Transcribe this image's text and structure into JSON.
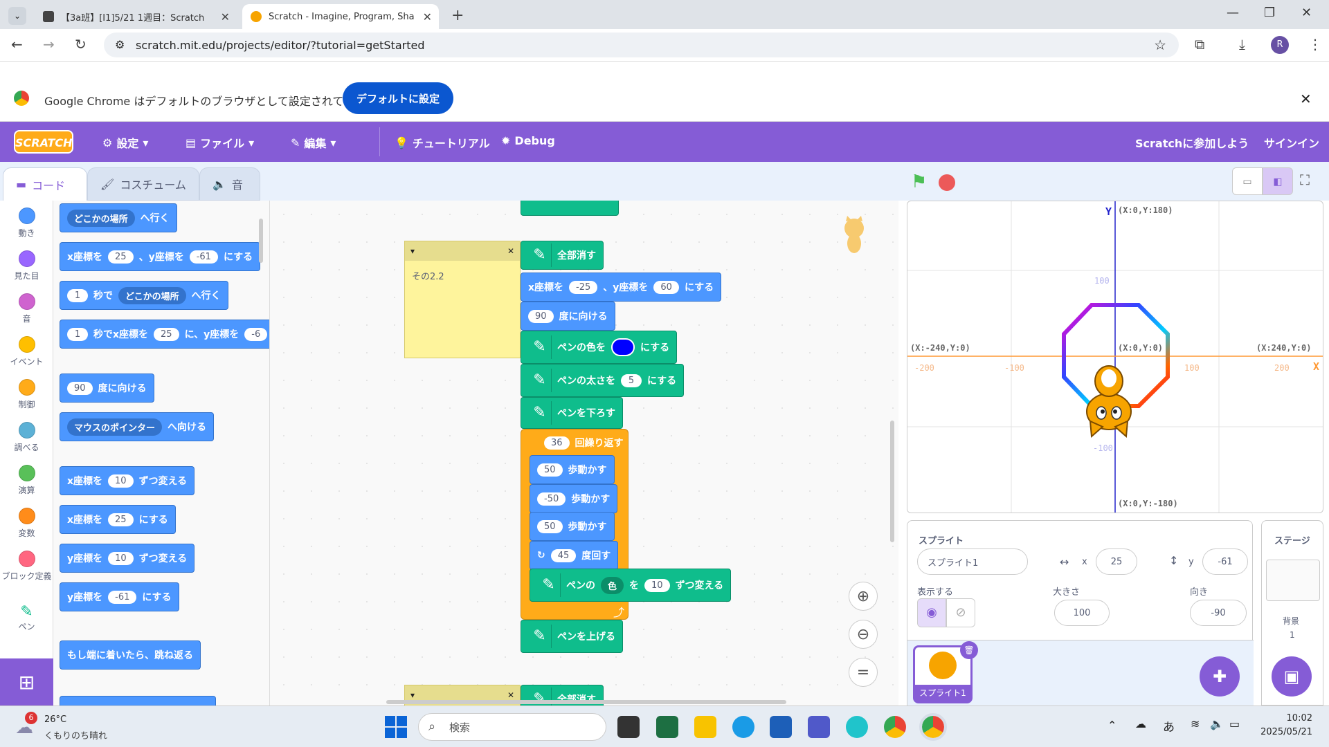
{
  "browser": {
    "tabs": [
      {
        "title": "【3a班】[I1]5/21 1週目：Scratch",
        "active": false
      },
      {
        "title": "Scratch - Imagine, Program, Sha",
        "active": true
      }
    ],
    "url": "scratch.mit.edu/projects/editor/?tutorial=getStarted",
    "profile_initial": "R",
    "infobar_text": "Google Chrome はデフォルトのブラウザとして設定されていません",
    "infobar_button": "デフォルトに設定"
  },
  "menu": {
    "logo": "SCRATCH",
    "settings": "設定",
    "file": "ファイル",
    "edit": "編集",
    "tutorial": "チュートリアル",
    "debug": "Debug",
    "join": "Scratchに参加しよう",
    "signin": "サインイン"
  },
  "editor_tabs": {
    "code": "コード",
    "costume": "コスチューム",
    "sound": "音"
  },
  "categories": [
    {
      "label": "動き",
      "color": "#4c97ff"
    },
    {
      "label": "見た目",
      "color": "#9966ff"
    },
    {
      "label": "音",
      "color": "#cf63cf"
    },
    {
      "label": "イベント",
      "color": "#ffbf00"
    },
    {
      "label": "制御",
      "color": "#ffab19"
    },
    {
      "label": "調べる",
      "color": "#5cb1d6"
    },
    {
      "label": "演算",
      "color": "#59c059"
    },
    {
      "label": "変数",
      "color": "#ff8c1a"
    },
    {
      "label": "ブロック定義",
      "color": "#ff6680"
    },
    {
      "label": "ペン",
      "color": "#0fbd8c"
    }
  ],
  "palette": {
    "goto_place": {
      "drop": "どこかの場所",
      "tail": "へ行く"
    },
    "set_xy": {
      "a": "x座標を",
      "x": "25",
      "b": "、y座標を",
      "y": "-61",
      "c": "にする"
    },
    "glide_place": {
      "n": "1",
      "a": "秒で",
      "drop": "どこかの場所",
      "tail": "へ行く"
    },
    "glide_xy": {
      "n": "1",
      "a": "秒でx座標を",
      "x": "25",
      "b": "に、y座標を",
      "y": "-6"
    },
    "point_dir": {
      "n": "90",
      "a": "度に向ける"
    },
    "point_towards": {
      "drop": "マウスのポインター",
      "tail": "へ向ける"
    },
    "change_x": {
      "a": "x座標を",
      "n": "10",
      "b": "ずつ変える"
    },
    "set_x": {
      "a": "x座標を",
      "n": "25",
      "b": "にする"
    },
    "change_y": {
      "a": "y座標を",
      "n": "10",
      "b": "ずつ変える"
    },
    "set_y": {
      "a": "y座標を",
      "n": "-61",
      "b": "にする"
    },
    "bounce": "もし端に着いたら、跳ね返る"
  },
  "script": {
    "note": "その2.2",
    "clear": "全部消す",
    "setxy": {
      "a": "x座標を",
      "x": "-25",
      "b": "、y座標を",
      "y": "60",
      "c": "にする"
    },
    "point": {
      "n": "90",
      "a": "度に向ける"
    },
    "pencolor": {
      "a": "ペンの色を",
      "b": "にする",
      "color": "#0000ff"
    },
    "pensize": {
      "a": "ペンの太さを",
      "n": "5",
      "b": "にする"
    },
    "pendown": "ペンを下ろす",
    "repeat": {
      "n": "36",
      "a": "回繰り返す"
    },
    "move1": {
      "n": "50",
      "a": "歩動かす"
    },
    "move2": {
      "n": "-50",
      "a": "歩動かす"
    },
    "move3": {
      "n": "50",
      "a": "歩動かす"
    },
    "turn": {
      "n": "45",
      "a": "度回す"
    },
    "changepen": {
      "a": "ペンの",
      "drop": "色",
      "b": "を",
      "n": "10",
      "c": "ずつ変える"
    },
    "penup": "ペンを上げる",
    "clear2": "全部消す"
  },
  "stage": {
    "top": "(X:0,Y:180)",
    "bottom": "(X:0,Y:-180)",
    "left": "(X:-240,Y:0)",
    "right": "(X:240,Y:0)",
    "center": "(X:0,Y:0)",
    "xaxis": "X",
    "yaxis": "Y",
    "ticks_x": [
      "-200",
      "-100",
      "100",
      "200"
    ],
    "ticks_y": [
      "100",
      "-100"
    ]
  },
  "sprite_panel": {
    "sprite_label": "スプライト",
    "sprite_name": "スプライト1",
    "x_label": "x",
    "x": "25",
    "y_label": "y",
    "y": "-61",
    "show_label": "表示する",
    "size_label": "大きさ",
    "size": "100",
    "dir_label": "向き",
    "direction": "-90",
    "thumb_name": "スプライト1"
  },
  "stage_panel": {
    "label": "ステージ",
    "backdrop_label": "背景",
    "backdrop_count": "1"
  },
  "taskbar": {
    "temp": "26°C",
    "weather": "くもりのち晴れ",
    "badge": "6",
    "search": "検索",
    "ime": "あ",
    "time": "10:02",
    "date": "2025/05/21"
  }
}
